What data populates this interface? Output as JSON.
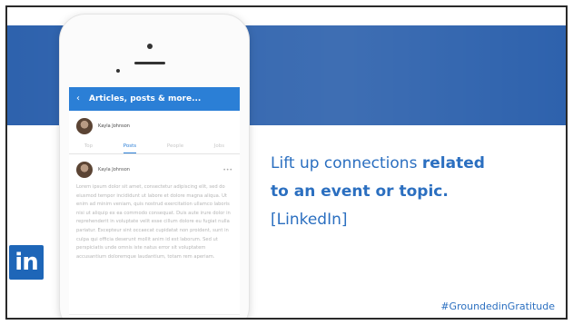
{
  "slide": {
    "line1": "Lift up connections ",
    "line1_bold": "related",
    "line2_bold": "to an event or topic.",
    "line3": "[LinkedIn]",
    "logo_text": "in",
    "hashtag": "#GroundedinGratitude"
  },
  "phone": {
    "header_title": "Articles, posts & more...",
    "profile_name": "Kayla Johnson",
    "tabs": [
      "Top",
      "Posts",
      "People",
      "Jobs"
    ],
    "post_author": "Kayla Johnson",
    "post_text": "Lorem ipsum dolor sit amet, consectetur adipiscing elit, sed do eiusmod tempor incididunt ut labore et dolore magna aliqua. Ut enim ad minim veniam, quis nostrud exercitation ullamco laboris nisi ut aliquip ex ea commodo consequat. Duis aute irure dolor in reprehenderit in voluptate velit esse cillum dolore eu fugiat nulla pariatur. Excepteur sint occaecat cupidatat non proident, sunt in culpa qui officia deserunt mollit anim id est laborum. Sed ut perspiciatis unde omnis iste natus error sit voluptatem accusantium doloremque laudantium, totam rem aperiam."
  },
  "colors": {
    "band": "#2e62ad",
    "app_header": "#2b7fd6",
    "text_blue": "#2b6fc0",
    "logo": "#1e66b8"
  }
}
